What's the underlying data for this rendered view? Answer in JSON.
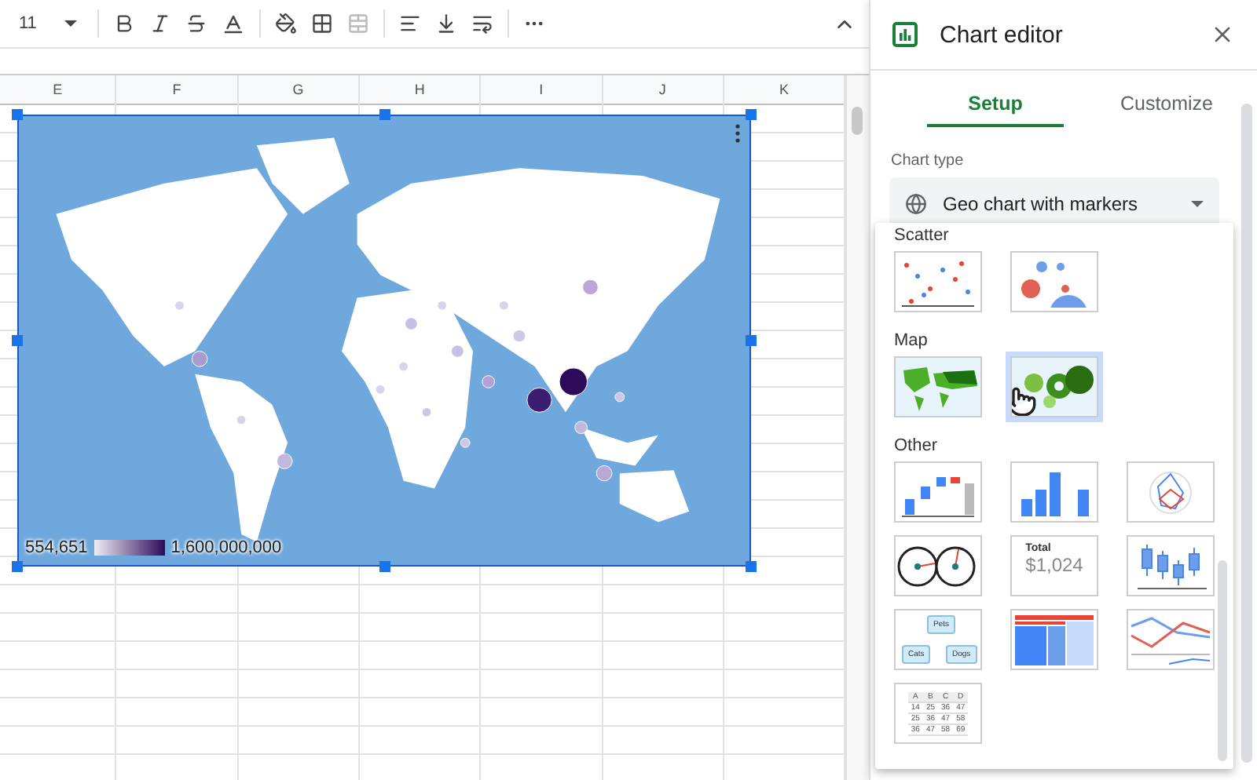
{
  "toolbar": {
    "font_size": "11"
  },
  "columns": [
    "E",
    "F",
    "G",
    "H",
    "I",
    "J",
    "K"
  ],
  "chart": {
    "legend_min": "554,651",
    "legend_max": "1,600,000,000"
  },
  "editor": {
    "title": "Chart editor",
    "tabs": [
      {
        "label": "Setup",
        "selected": true
      },
      {
        "label": "Customize",
        "selected": false
      }
    ],
    "chart_type_label": "Chart type",
    "chart_type_value": "Geo chart with markers",
    "sections": [
      {
        "title": "Scatter",
        "options": [
          {
            "kind": "scatter",
            "selected": false
          },
          {
            "kind": "bubble",
            "selected": false
          }
        ]
      },
      {
        "title": "Map",
        "options": [
          {
            "kind": "geo",
            "selected": false
          },
          {
            "kind": "geo_markers",
            "selected": true
          }
        ]
      },
      {
        "title": "Other",
        "options": [
          {
            "kind": "waterfall",
            "selected": false
          },
          {
            "kind": "histogram",
            "selected": false
          },
          {
            "kind": "radar",
            "selected": false
          },
          {
            "kind": "gauge",
            "selected": false
          },
          {
            "kind": "scorecard",
            "selected": false,
            "label": "Total",
            "value": "$1,024"
          },
          {
            "kind": "candlestick",
            "selected": false
          },
          {
            "kind": "org",
            "selected": false,
            "nodes": [
              "Pets",
              "Cats",
              "Dogs"
            ]
          },
          {
            "kind": "treemap",
            "selected": false
          },
          {
            "kind": "timeline",
            "selected": false
          },
          {
            "kind": "table",
            "selected": false,
            "header": [
              "A",
              "B",
              "C",
              "D"
            ],
            "rows": [
              [
                "14",
                "25",
                "36",
                "47"
              ],
              [
                "25",
                "36",
                "47",
                "58"
              ],
              [
                "36",
                "47",
                "58",
                "69"
              ]
            ]
          }
        ]
      }
    ]
  }
}
